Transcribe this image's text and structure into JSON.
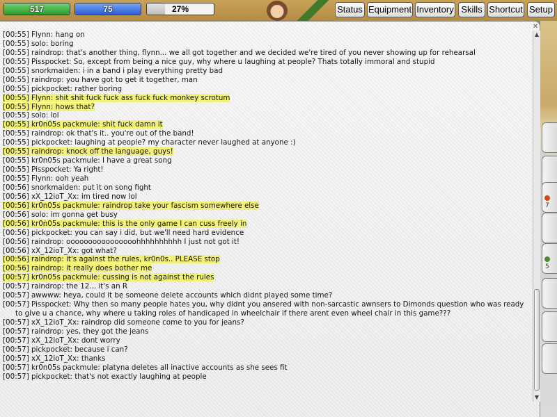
{
  "hud": {
    "hp": "517",
    "mp": "75",
    "xp": "27%",
    "xp_fraction": 0.27
  },
  "menu": [
    {
      "label": "Status"
    },
    {
      "label": "Equipment"
    },
    {
      "label": "Inventory"
    },
    {
      "label": "Skills"
    },
    {
      "label": "Shortcut"
    },
    {
      "label": "Setup"
    }
  ],
  "side_tabs": [
    {
      "num": ""
    },
    {
      "num": ""
    },
    {
      "num": "7"
    },
    {
      "num": ""
    },
    {
      "num": "5"
    },
    {
      "num": ""
    },
    {
      "num": ""
    },
    {
      "num": ""
    }
  ],
  "chat": {
    "lines": [
      {
        "t": "[00:55]",
        "msg": "Flynn: hang on",
        "hl": false
      },
      {
        "t": "[00:55]",
        "msg": "solo: boring",
        "hl": false
      },
      {
        "t": "[00:55]",
        "msg": "raindrop: that's another thing, flynn... we all got together and we decided we're tired of you never showing up for rehearsal",
        "hl": false
      },
      {
        "t": "[00:55]",
        "msg": "Pisspocket: So, except from being a nice guy, why where u laughing at people? Thats totally immoral and stupid",
        "hl": false
      },
      {
        "t": "[00:55]",
        "msg": "snorkmaiden: i in a band i play everything pretty bad",
        "hl": false
      },
      {
        "t": "[00:55]",
        "msg": "raindrop: you have got to get it together, man",
        "hl": false
      },
      {
        "t": "[00:55]",
        "msg": "pickpocket: rather boring",
        "hl": false
      },
      {
        "t": "[00:55]",
        "msg": "Flynn: shit shit fuck fuck ass fuck fuck monkey scrotum",
        "hl": true
      },
      {
        "t": "[00:55]",
        "msg": "Flynn: hows that?",
        "hl": true
      },
      {
        "t": "[00:55]",
        "msg": "solo: lol",
        "hl": false
      },
      {
        "t": "[00:55]",
        "msg": "kr0n05s packmule: shit fuck damn it",
        "hl": true
      },
      {
        "t": "[00:55]",
        "msg": "raindrop: ok that's it.. you're out of the band!",
        "hl": false
      },
      {
        "t": "[00:55]",
        "msg": "pickpocket: laughing at people? my character never laughed at anyone :)",
        "hl": false
      },
      {
        "t": "[00:55]",
        "msg": "raindrop: knock off the language, guys!",
        "hl": true
      },
      {
        "t": "[00:55]",
        "msg": "kr0n05s packmule: I have a great song",
        "hl": false
      },
      {
        "t": "[00:55]",
        "msg": "Pisspocket: Ya right!",
        "hl": false
      },
      {
        "t": "[00:55]",
        "msg": "Flynn: ooh yeah",
        "hl": false
      },
      {
        "t": "[00:56]",
        "msg": "snorkmaiden: put it on song fight",
        "hl": false
      },
      {
        "t": "[00:56]",
        "msg": "xX_12ioT_Xx: im tired now lol",
        "hl": false
      },
      {
        "t": "[00:56]",
        "msg": "kr0n05s packmule: raindrop take your fascism somewhere else",
        "hl": true
      },
      {
        "t": "[00:56]",
        "msg": "solo: im gonna get busy",
        "hl": false
      },
      {
        "t": "[00:56]",
        "msg": "kr0n05s packmule: this is the only game I can cuss freely in",
        "hl": true
      },
      {
        "t": "[00:56]",
        "msg": "pickpocket: you can say i did, but we'll need hard evidence",
        "hl": false
      },
      {
        "t": "[00:56]",
        "msg": "raindrop: oooooooooooooooohhhhhhhhhh I just not got it!",
        "hl": false
      },
      {
        "t": "[00:56]",
        "msg": "xX_12ioT_Xx: got what?",
        "hl": false
      },
      {
        "t": "[00:56]",
        "msg": "raindrop: it's against the rules, kr0n0s.. PLEASE stop",
        "hl": true
      },
      {
        "t": "[00:56]",
        "msg": "raindrop: it really does bother me",
        "hl": true
      },
      {
        "t": "[00:57]",
        "msg": "kr0n05s packmule: cussing is not against the rules",
        "hl": true
      },
      {
        "t": "[00:57]",
        "msg": "raindrop: the 12... it's an R",
        "hl": false
      },
      {
        "t": "[00:57]",
        "msg": "awwww: heya, could it be someone delete accounts which didnt played some time?",
        "hl": false
      },
      {
        "t": "[00:57]",
        "msg": "Pisspocket: Why then so many people hates you, why didnt you ansered with non-sarcastic awnsers to Dimonds question who was ready to give u a chance, why where u taking roles of handicaped in wheelchair if there arent even wheel chair in this game???",
        "hl": false
      },
      {
        "t": "[00:57]",
        "msg": "xX_12ioT_Xx: raindrop did someone come to you for jeans?",
        "hl": false
      },
      {
        "t": "[00:57]",
        "msg": "raindrop: yes, they got the jeans",
        "hl": false
      },
      {
        "t": "[00:57]",
        "msg": "xX_12ioT_Xx: dont worry",
        "hl": false
      },
      {
        "t": "[00:57]",
        "msg": "pickpocket: because i can?",
        "hl": false
      },
      {
        "t": "[00:57]",
        "msg": "xX_12ioT_Xx: thanks",
        "hl": false
      },
      {
        "t": "[00:57]",
        "msg": "kr0n05s packmule: platyna deletes all inactive accounts as she sees fit",
        "hl": false
      },
      {
        "t": "[00:57]",
        "msg": "pickpocket: that's not exactly laughing at people",
        "hl": false
      }
    ]
  }
}
